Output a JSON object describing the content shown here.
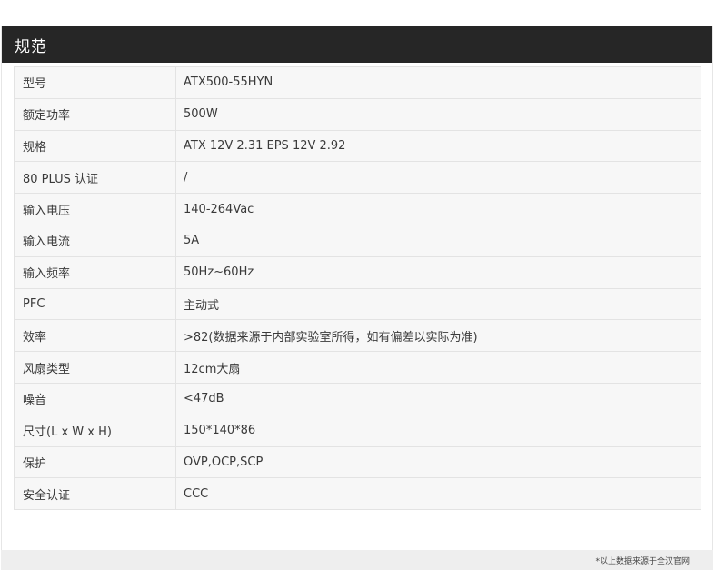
{
  "section": {
    "title": "规范"
  },
  "specs": [
    {
      "label": "型号",
      "value": "ATX500-55HYN"
    },
    {
      "label": "额定功率",
      "value": "500W"
    },
    {
      "label": "规格",
      "value": "ATX 12V 2.31 EPS 12V 2.92"
    },
    {
      "label": "80 PLUS 认证",
      "value": "/"
    },
    {
      "label": "输入电压",
      "value": "140-264Vac"
    },
    {
      "label": "输入电流",
      "value": "5A"
    },
    {
      "label": "输入频率",
      "value": "50Hz~60Hz"
    },
    {
      "label": "PFC",
      "value": "主动式"
    },
    {
      "label": "效率",
      "value": ">82(数据来源于内部实验室所得，如有偏差以实际为准)"
    },
    {
      "label": "风扇类型",
      "value": "12cm大扇"
    },
    {
      "label": "噪音",
      "value": "<47dB"
    },
    {
      "label": "尺寸(L x W x H)",
      "value": "150*140*86"
    },
    {
      "label": "保护",
      "value": "OVP,OCP,SCP"
    },
    {
      "label": "安全认证",
      "value": "CCC"
    }
  ],
  "footer": {
    "note": "*以上数据来源于全汉官网"
  },
  "colors": {
    "header_bg": "#262626",
    "header_text": "#ffffff",
    "table_bg": "#f7f7f7",
    "border": "#e3e3e3",
    "footer_bg": "#eeeeee"
  }
}
